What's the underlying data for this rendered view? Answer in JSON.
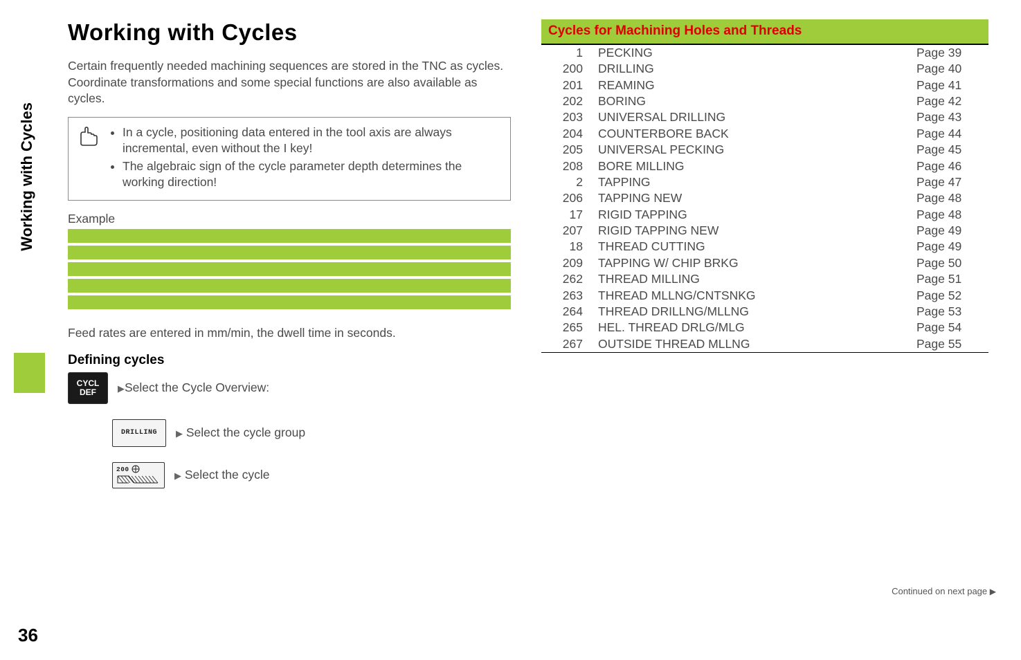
{
  "side_tab": "Working with Cycles",
  "page_number": "36",
  "title": "Working with Cycles",
  "intro": "Certain frequently needed machining sequences are stored in the TNC as cycles. Coordinate transformations and some special functions are also available as cycles.",
  "note": {
    "bullets": [
      "In a cycle, positioning data entered in the tool axis are always incremental, even without the I key!",
      "The algebraic sign of the cycle parameter depth determines the working direction!"
    ]
  },
  "example_label": "Example",
  "feed_note": "Feed rates are entered in mm/min, the dwell time in seconds.",
  "defining_cycles_head": "Defining cycles",
  "keys": {
    "cycl_def": "CYCL\nDEF",
    "drilling": "DRILLING",
    "200": "200"
  },
  "steps": {
    "select_overview": "Select the Cycle Overview:",
    "select_group": "Select the cycle group",
    "select_cycle": "Select the cycle"
  },
  "section_banner": "Cycles for Machining Holes and Threads",
  "cycles": [
    {
      "num": "1",
      "name": "PECKING",
      "page": "Page 39"
    },
    {
      "num": "200",
      "name": "DRILLING",
      "page": "Page 40"
    },
    {
      "num": "201",
      "name": "REAMING",
      "page": "Page 41"
    },
    {
      "num": "202",
      "name": "BORING",
      "page": "Page 42"
    },
    {
      "num": "203",
      "name": "UNIVERSAL DRILLING",
      "page": "Page 43"
    },
    {
      "num": "204",
      "name": "COUNTERBORE BACK",
      "page": "Page 44"
    },
    {
      "num": "205",
      "name": "UNIVERSAL PECKING",
      "page": "Page 45"
    },
    {
      "num": "208",
      "name": "BORE MILLING",
      "page": "Page 46"
    },
    {
      "num": "2",
      "name": "TAPPING",
      "page": "Page 47"
    },
    {
      "num": "206",
      "name": "TAPPING NEW",
      "page": "Page 48"
    },
    {
      "num": "17",
      "name": "RIGID TAPPING",
      "page": "Page 48"
    },
    {
      "num": "207",
      "name": "RIGID TAPPING NEW",
      "page": "Page 49"
    },
    {
      "num": "18",
      "name": "THREAD CUTTING",
      "page": "Page 49"
    },
    {
      "num": "209",
      "name": "TAPPING W/ CHIP BRKG",
      "page": "Page 50"
    },
    {
      "num": "262",
      "name": "THREAD MILLING",
      "page": "Page 51"
    },
    {
      "num": "263",
      "name": "THREAD MLLNG/CNTSNKG",
      "page": "Page 52"
    },
    {
      "num": "264",
      "name": "THREAD DRILLNG/MLLNG",
      "page": "Page 53"
    },
    {
      "num": "265",
      "name": "HEL. THREAD DRLG/MLG",
      "page": "Page 54"
    },
    {
      "num": "267",
      "name": "OUTSIDE THREAD MLLNG",
      "page": "Page  55"
    }
  ],
  "continued": "Continued on next page"
}
